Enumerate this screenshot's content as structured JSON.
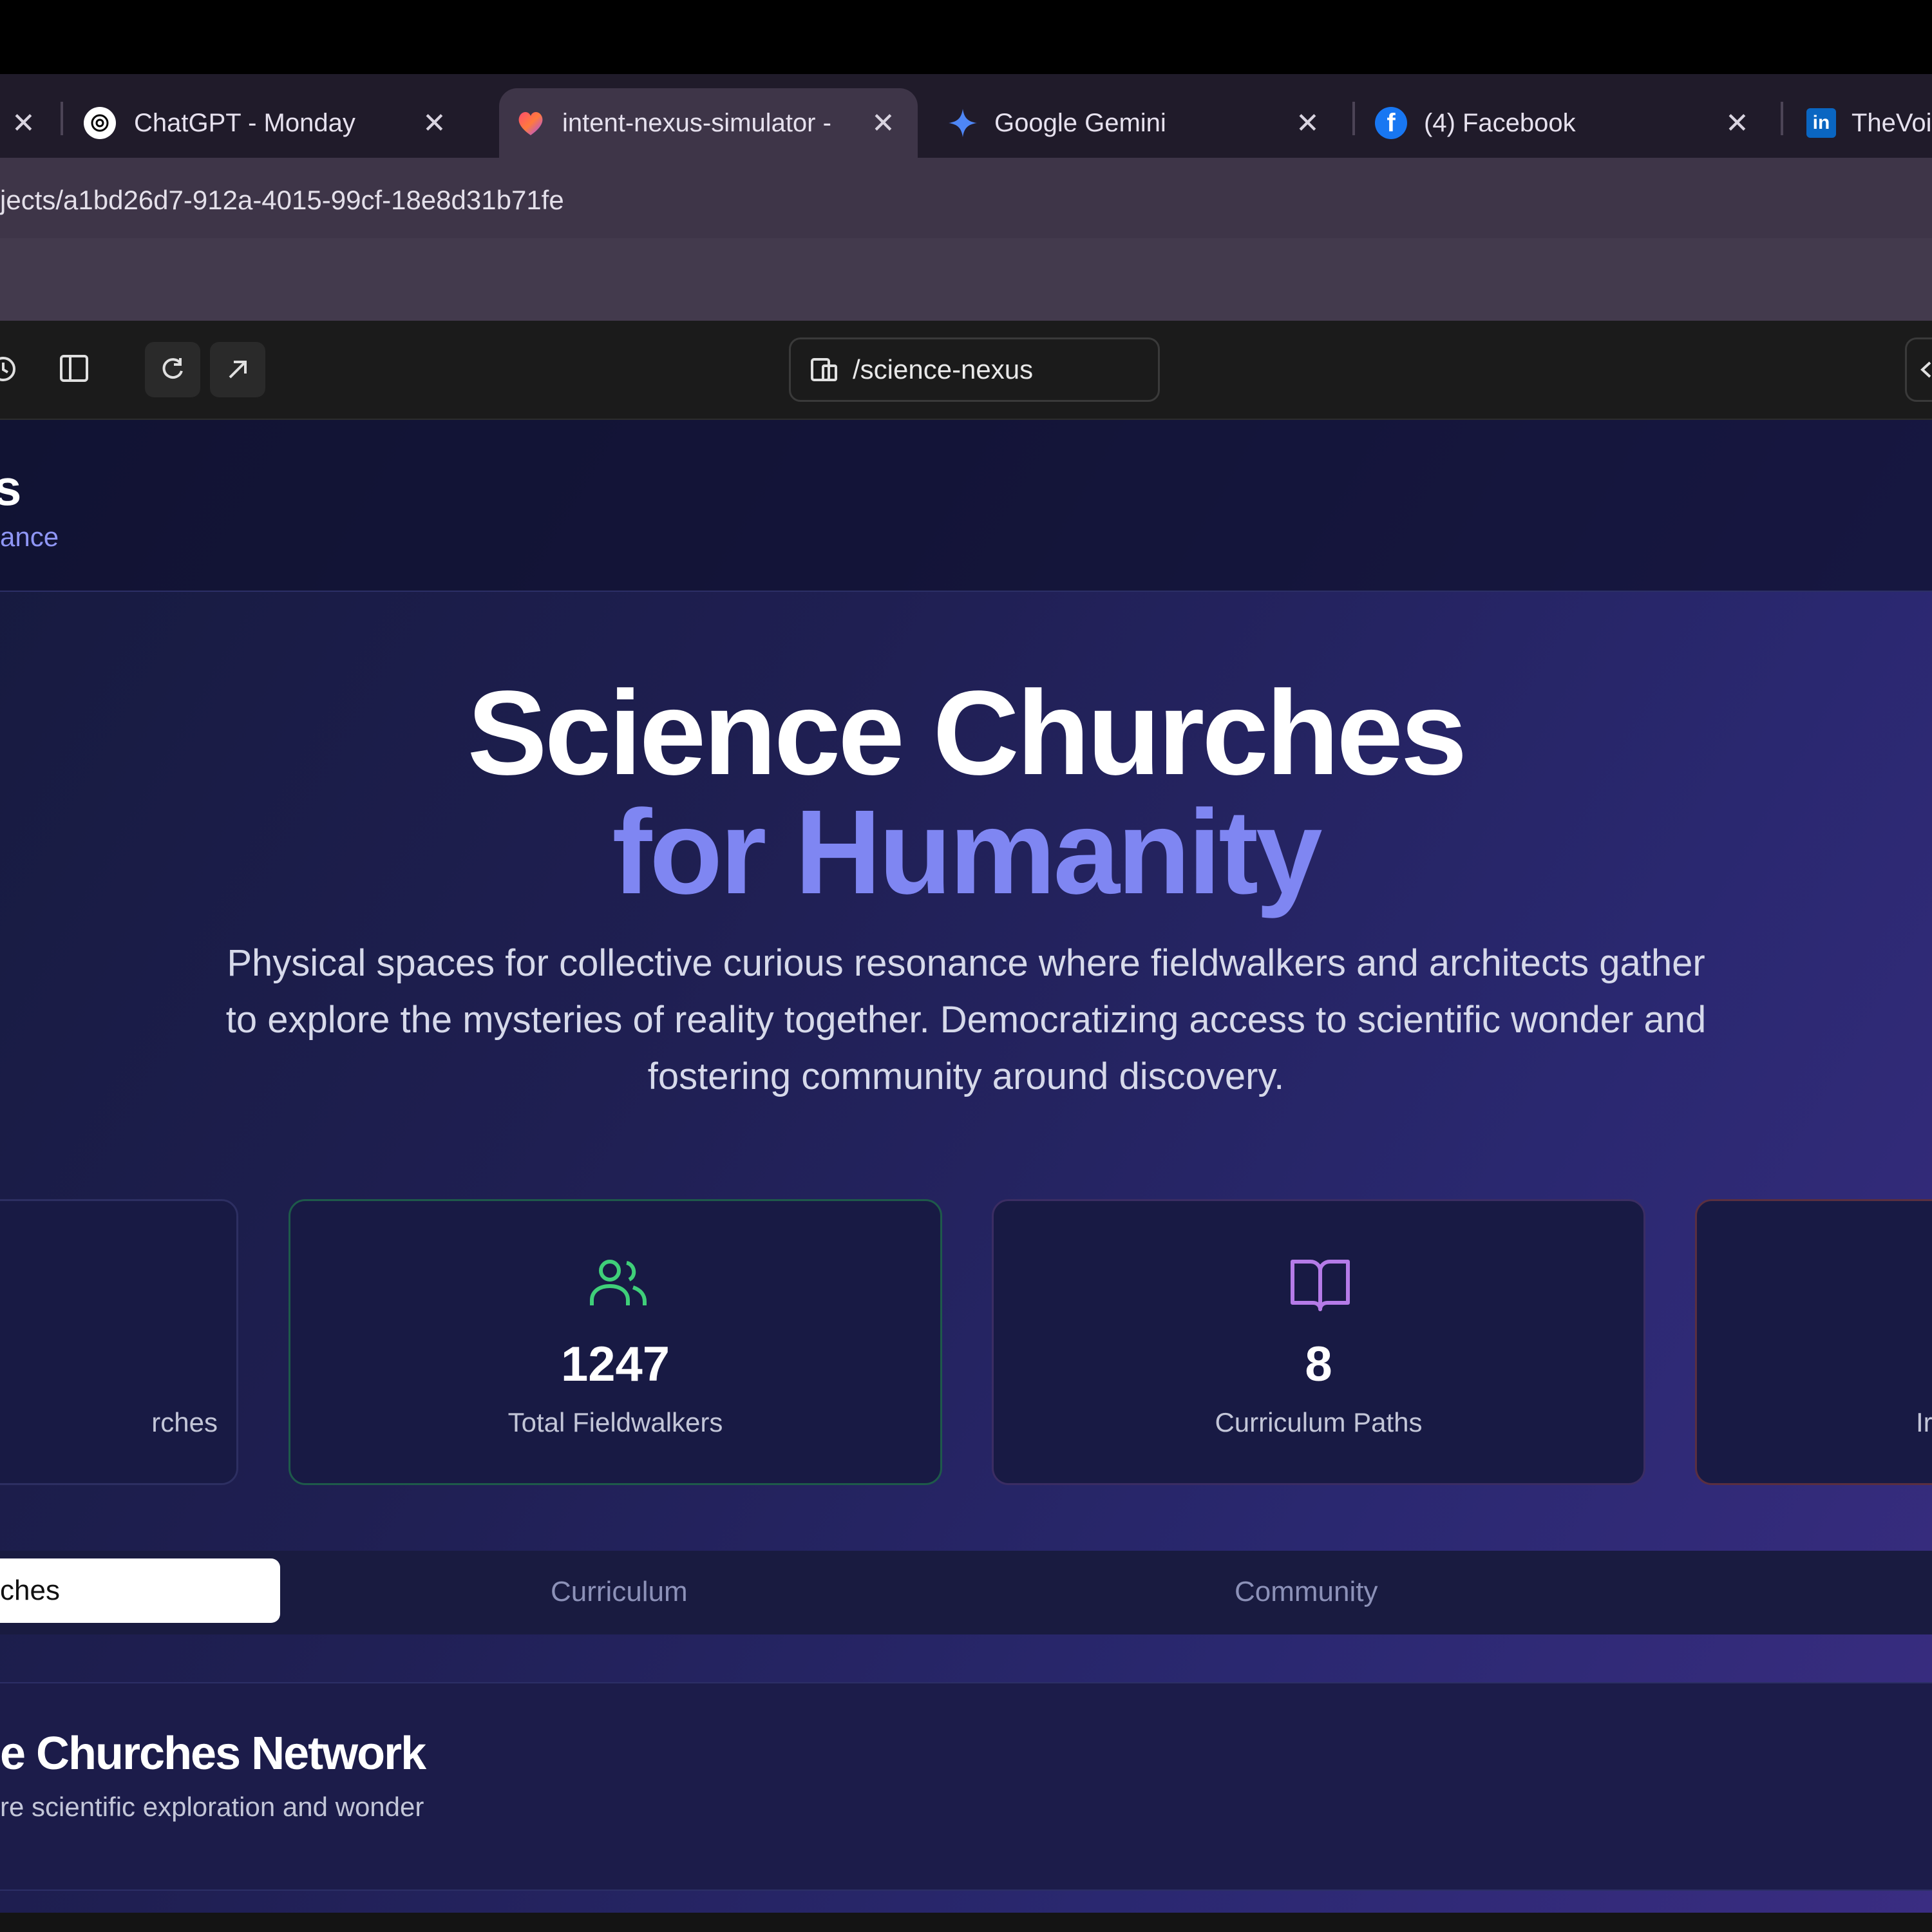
{
  "browser": {
    "tabs": [
      {
        "title": "ChatGPT - Monday",
        "icon": "chatgpt-icon",
        "close": "✕"
      },
      {
        "title": "intent-nexus-simulator -",
        "icon": "app-heart-icon",
        "close": "✕",
        "active": true
      },
      {
        "title": "Google Gemini",
        "icon": "gemini-icon",
        "close": "✕"
      },
      {
        "title": "(4) Facebook",
        "icon": "facebook-icon",
        "close": "✕"
      },
      {
        "title": "TheVoi",
        "icon": "linkedin-icon"
      }
    ],
    "first_close": "✕",
    "url": "jects/a1bd26d7-912a-4015-99cf-18e8d31b71fe"
  },
  "preview": {
    "path": "/science-nexus"
  },
  "nav": {
    "title_fragment": "s",
    "subtitle_fragment": "ance"
  },
  "hero": {
    "line1": "Science Churches",
    "line2": "for Humanity",
    "description": "Physical spaces for collective curious resonance where fieldwalkers and architects gather to explore the mysteries of reality together. Democratizing access to scientific wonder and fostering community around discovery."
  },
  "stats": [
    {
      "label": "rches"
    },
    {
      "value": "1247",
      "label": "Total Fieldwalkers",
      "icon": "users-icon",
      "accent": "#3fcf79"
    },
    {
      "value": "8",
      "label": "Curriculum Paths",
      "icon": "book-open-icon",
      "accent": "#b57be8"
    },
    {
      "label": "Ir"
    }
  ],
  "tabs": {
    "active": "ches",
    "curriculum": "Curriculum",
    "community": "Community"
  },
  "section": {
    "title": "e Churches Network",
    "subtitle": "re scientific exploration and wonder"
  },
  "colors": {
    "accent_indigo": "#7f86f2",
    "green": "#3fcf79",
    "purple": "#b57be8"
  }
}
